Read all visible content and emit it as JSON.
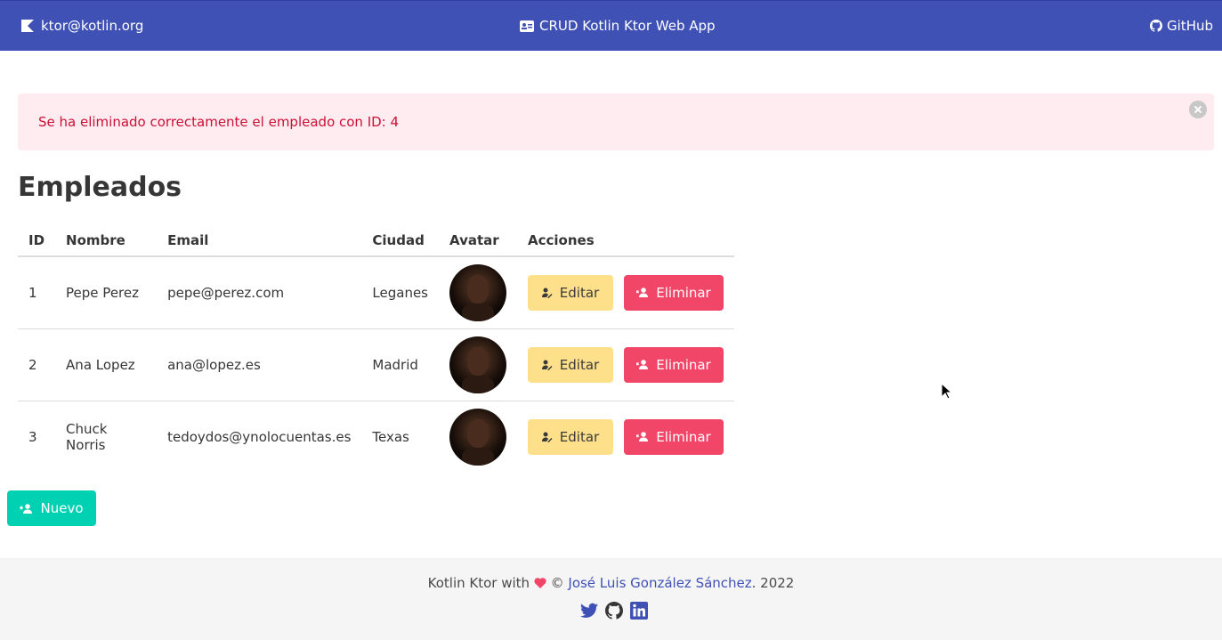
{
  "navbar": {
    "brand_icon": "kotlin-logo-icon",
    "brand_text": "ktor@kotlin.org",
    "title_icon": "id-card-icon",
    "title_text": "CRUD Kotlin Ktor Web App",
    "github_icon": "github-icon",
    "github_text": "GitHub",
    "color": "#3f51b5"
  },
  "notification": {
    "message": "Se ha eliminado correctamente el empleado con ID: 4",
    "color": "#cc0f35",
    "background": "#feecf0"
  },
  "page_title": "Empleados",
  "table": {
    "headers": [
      "ID",
      "Nombre",
      "Email",
      "Ciudad",
      "Avatar",
      "Acciones"
    ],
    "rows": [
      {
        "id": "1",
        "nombre": "Pepe Perez",
        "email": "pepe@perez.com",
        "ciudad": "Leganes"
      },
      {
        "id": "2",
        "nombre": "Ana Lopez",
        "email": "ana@lopez.es",
        "ciudad": "Madrid"
      },
      {
        "id": "3",
        "nombre": "Chuck Norris",
        "email": "tedoydos@ynolocuentas.es",
        "ciudad": "Texas"
      }
    ],
    "edit_label": "Editar",
    "delete_label": "Eliminar"
  },
  "new_button": {
    "label": "Nuevo"
  },
  "footer": {
    "prefix": "Kotlin Ktor with",
    "copyright": "©",
    "author": "José Luis González Sánchez",
    "year": ". 2022",
    "icons": [
      "twitter-icon",
      "github-icon",
      "linkedin-icon"
    ]
  },
  "colors": {
    "warning": "#ffe08a",
    "danger": "#f14668",
    "primary": "#00d1b2",
    "footer_bg": "#f5f5f5"
  }
}
